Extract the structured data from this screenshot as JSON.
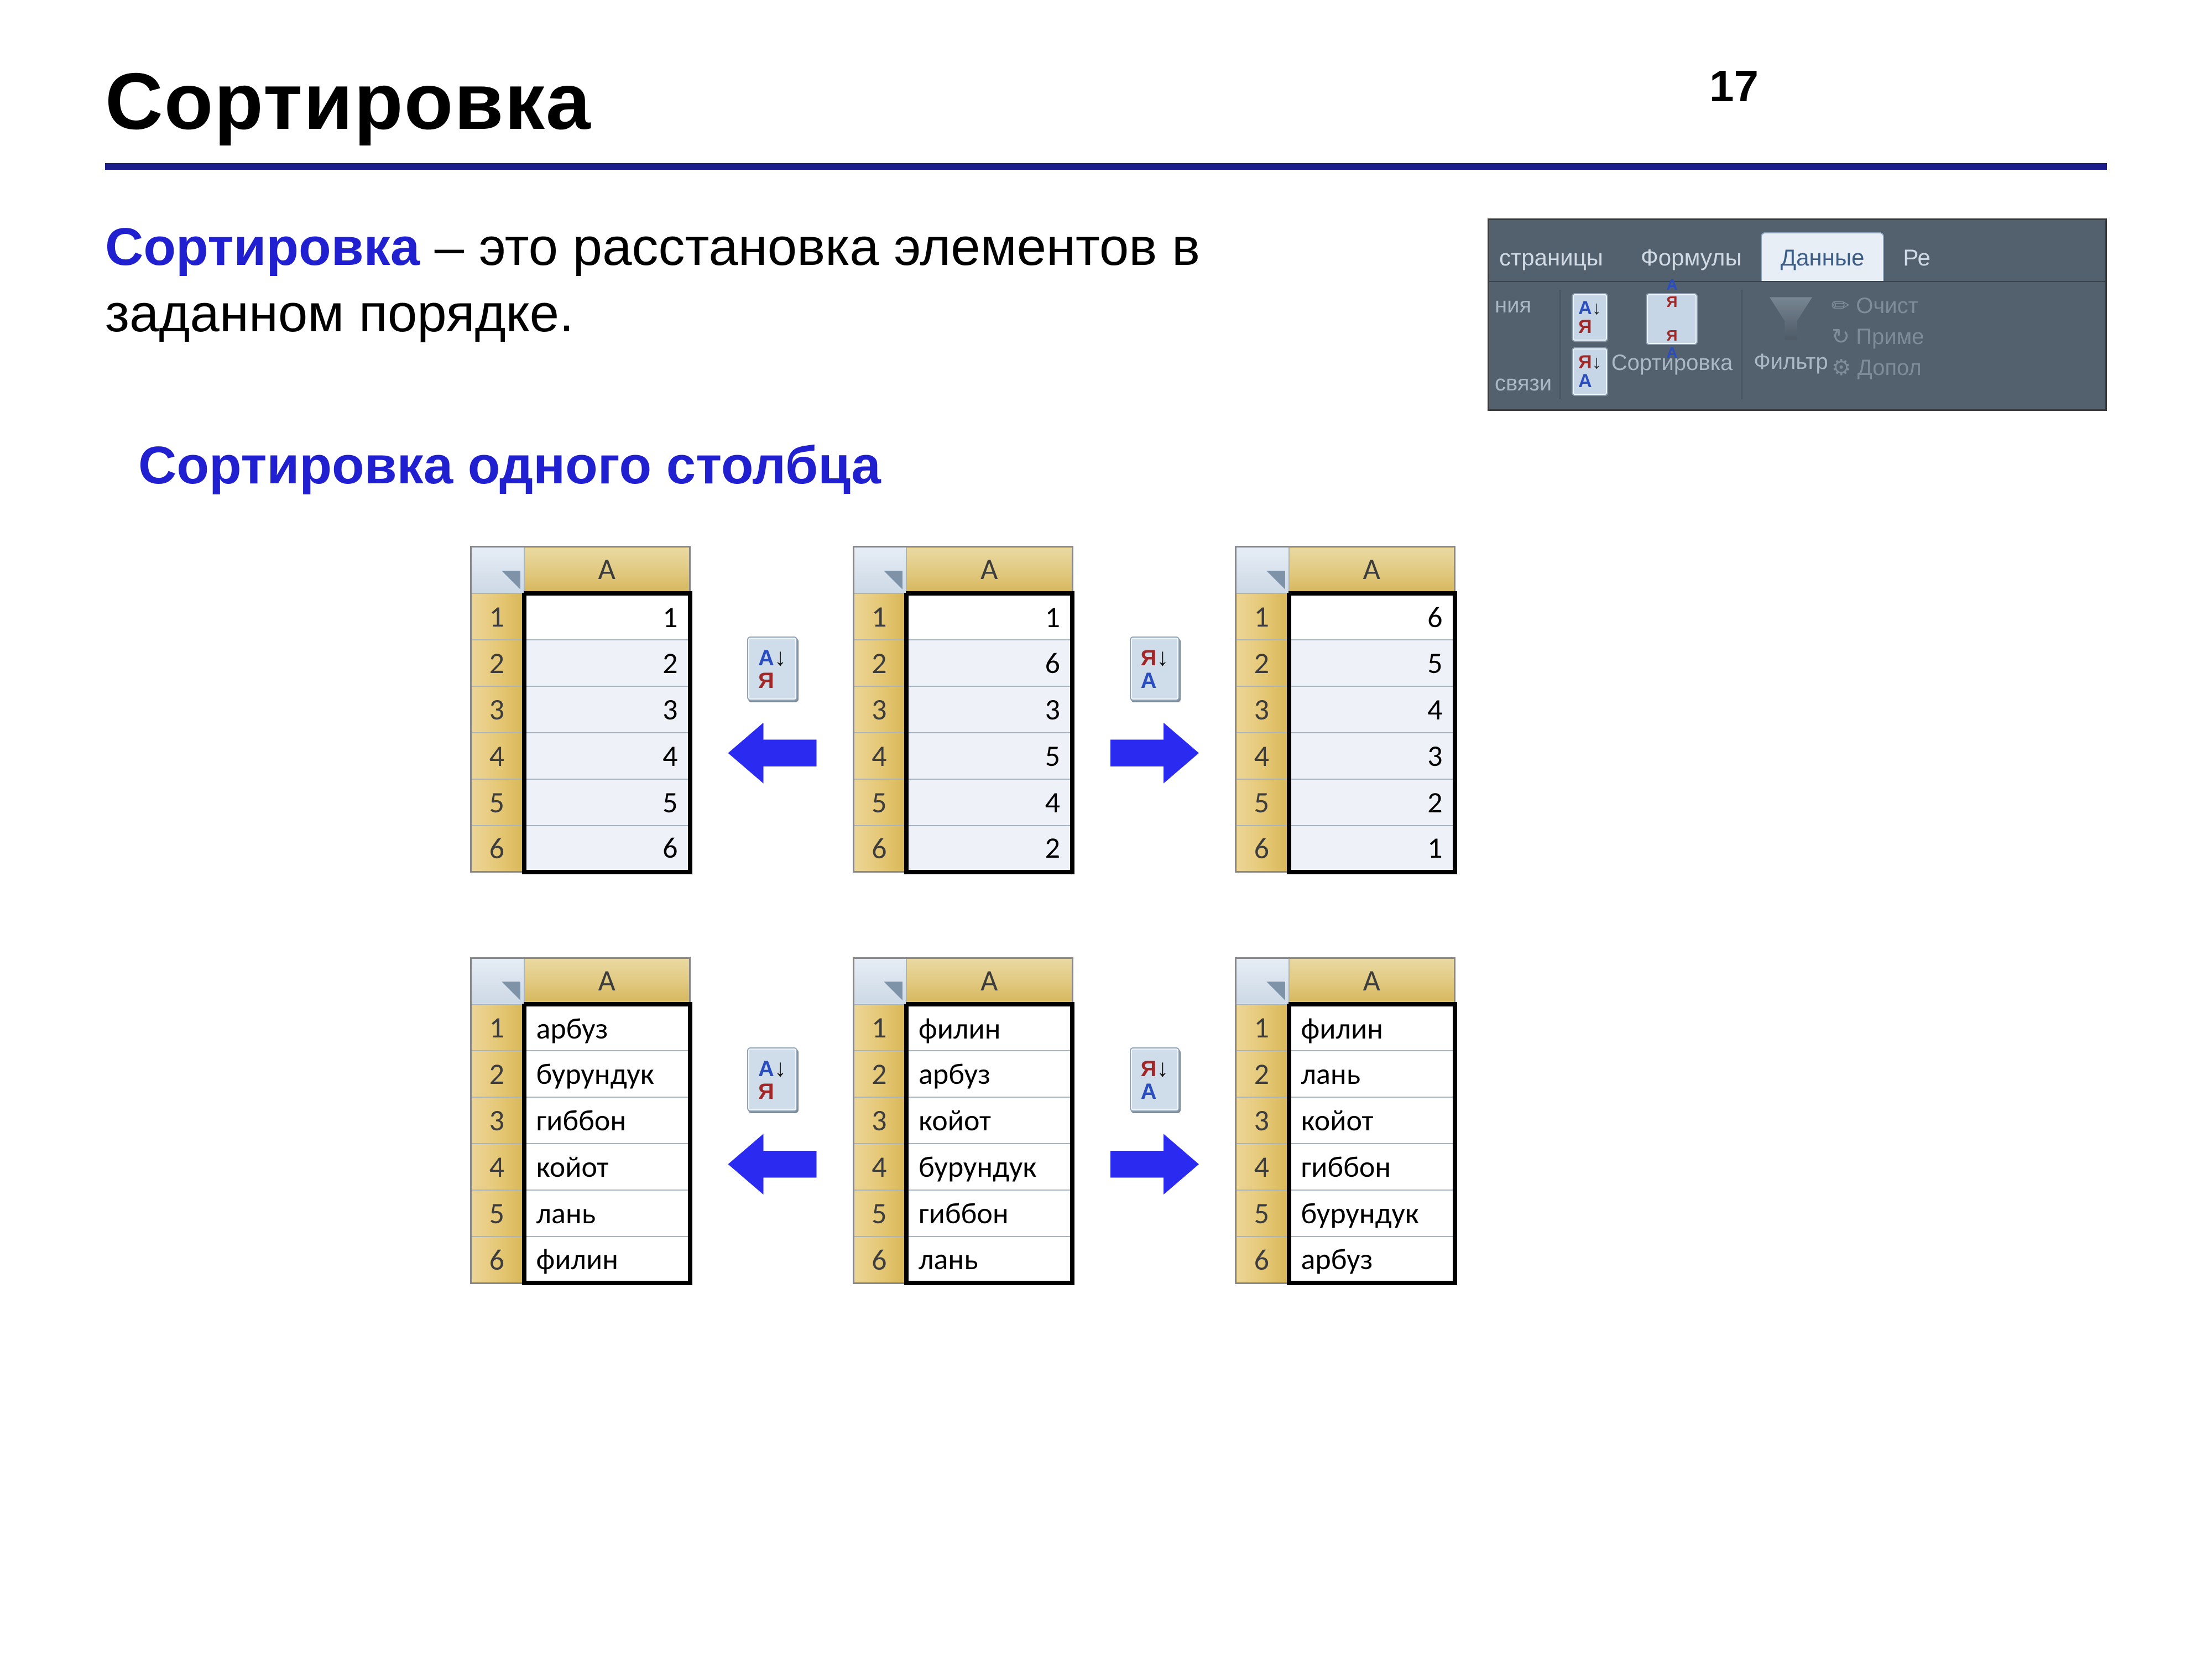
{
  "page_number": "17",
  "title": "Сортировка",
  "intro_term": "Сортировка",
  "intro_rest": " – это расстановка элементов в заданном порядке.",
  "subtitle": "Сортировка одного столбца",
  "ribbon": {
    "tab_part_left": "страницы",
    "tab_formulas": "Формулы",
    "tab_data": "Данные",
    "tab_part_right": "Ре",
    "left_top_frag": "ния",
    "left_bottom_frag": "связи",
    "sort_label": "Сортировка",
    "filter_label": "Фильтр",
    "opt1": "Очист",
    "opt2": "Приме",
    "opt3": "Допол"
  },
  "tables": {
    "col_label": "A",
    "asc_label": "АЯ↓",
    "desc_label": "ЯА↓",
    "num_sorted_asc": [
      "1",
      "2",
      "3",
      "4",
      "5",
      "6"
    ],
    "num_unsorted": [
      "1",
      "6",
      "3",
      "5",
      "4",
      "2"
    ],
    "num_sorted_desc": [
      "6",
      "5",
      "4",
      "3",
      "2",
      "1"
    ],
    "txt_sorted_asc": [
      "арбуз",
      "бурундук",
      "гиббон",
      "койот",
      "лань",
      "филин"
    ],
    "txt_unsorted": [
      "филин",
      "арбуз",
      "койот",
      "бурундук",
      "гиббон",
      "лань"
    ],
    "txt_sorted_desc": [
      "филин",
      "лань",
      "койот",
      "гиббон",
      "бурундук",
      "арбуз"
    ]
  }
}
